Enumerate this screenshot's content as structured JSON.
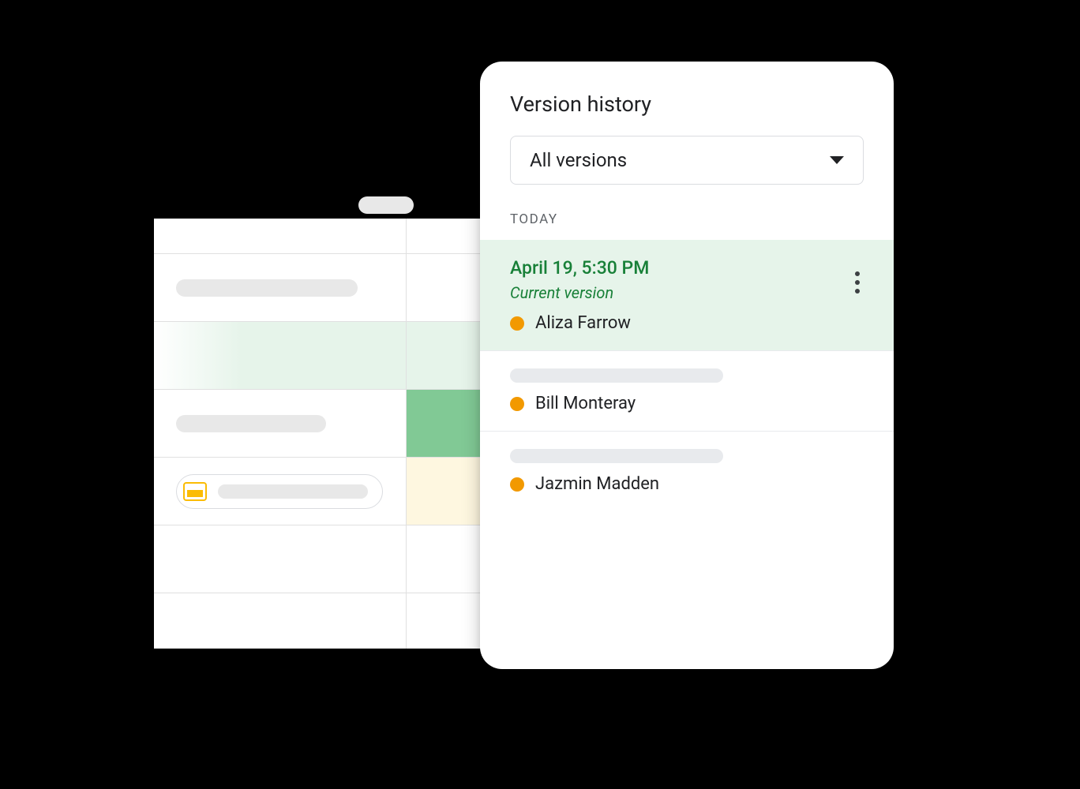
{
  "panel": {
    "title": "Version history",
    "dropdown_label": "All versions",
    "section_label": "Today",
    "versions": [
      {
        "timestamp": "April 19, 5:30 PM",
        "subtitle": "Current version",
        "editor": "Aliza Farrow",
        "selected": true
      },
      {
        "editor": "Bill Monteray"
      },
      {
        "editor": "Jazmin Madden"
      }
    ]
  },
  "colors": {
    "accent_green": "#188038",
    "selected_bg": "#e6f4ea",
    "editor_dot": "#f29900"
  },
  "icons": {
    "chip": "slides-icon",
    "dropdown": "caret-down",
    "more": "kebab"
  }
}
